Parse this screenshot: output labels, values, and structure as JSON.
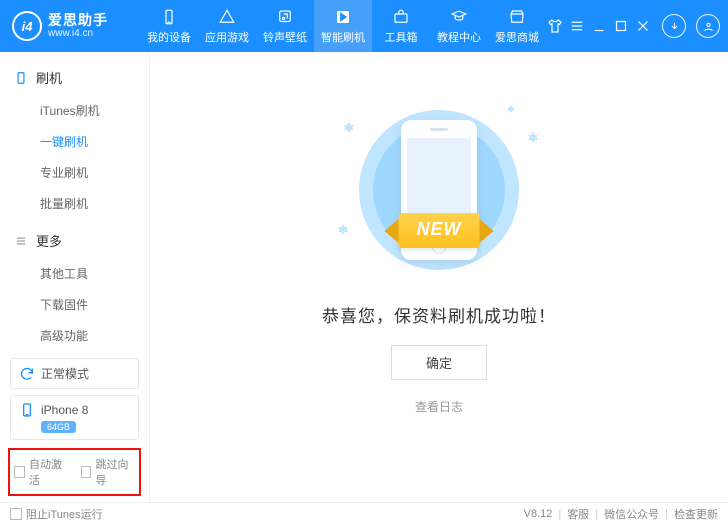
{
  "app": {
    "name": "爱思助手",
    "url": "www.i4.cn",
    "version": "V8.12"
  },
  "nav": {
    "items": [
      {
        "label": "我的设备"
      },
      {
        "label": "应用游戏"
      },
      {
        "label": "铃声壁纸"
      },
      {
        "label": "智能刷机"
      },
      {
        "label": "工具箱"
      },
      {
        "label": "教程中心"
      },
      {
        "label": "爱思商城"
      }
    ]
  },
  "sidebar": {
    "groups": [
      {
        "title": "刷机",
        "items": [
          "iTunes刷机",
          "一键刷机",
          "专业刷机",
          "批量刷机"
        ]
      },
      {
        "title": "更多",
        "items": [
          "其他工具",
          "下载固件",
          "高级功能"
        ]
      }
    ],
    "mode": "正常模式",
    "device": {
      "name": "iPhone 8",
      "storage": "64GB"
    },
    "auto_activate": "自动激活",
    "skip_guide": "跳过向导"
  },
  "main": {
    "ribbon": "NEW",
    "success": "恭喜您，保资料刷机成功啦！",
    "ok": "确定",
    "view_log": "查看日志"
  },
  "footer": {
    "block_itunes": "阻止iTunes运行",
    "links": [
      "客服",
      "微信公众号",
      "检查更新"
    ]
  }
}
